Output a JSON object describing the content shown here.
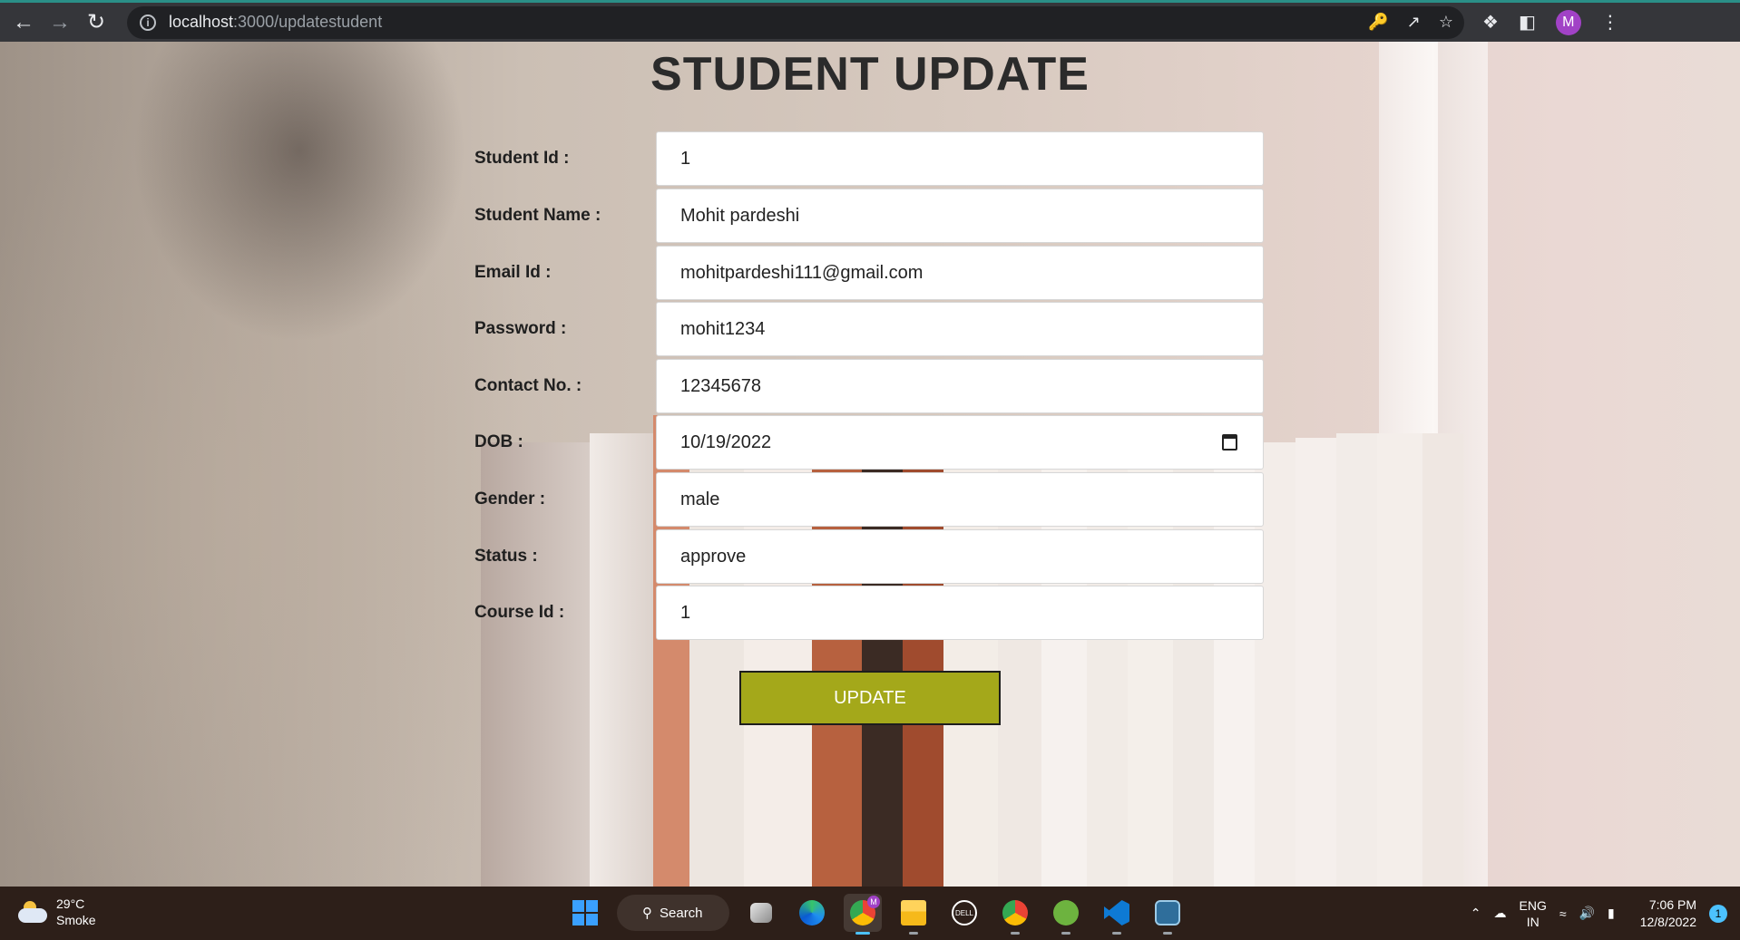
{
  "browser": {
    "url_host": "localhost",
    "url_path": ":3000/updatestudent",
    "profile_initial": "M"
  },
  "page": {
    "title": "STUDENT UPDATE",
    "fields": [
      {
        "label": "Student Id :",
        "value": "1"
      },
      {
        "label": "Student Name :",
        "value": "Mohit pardeshi"
      },
      {
        "label": "Email Id :",
        "value": "mohitpardeshi111@gmail.com"
      },
      {
        "label": "Password :",
        "value": "mohit1234"
      },
      {
        "label": "Contact No. :",
        "value": "12345678"
      },
      {
        "label": "DOB :",
        "value": "10/19/2022"
      },
      {
        "label": "Gender :",
        "value": "male"
      },
      {
        "label": "Status :",
        "value": "approve"
      },
      {
        "label": "Course Id :",
        "value": "1"
      }
    ],
    "update_label": "UPDATE",
    "accent_color": "#a4a81a"
  },
  "taskbar": {
    "weather_temp": "29°C",
    "weather_desc": "Smoke",
    "search_label": "Search",
    "lang_top": "ENG",
    "lang_bottom": "IN",
    "time": "7:06 PM",
    "date": "12/8/2022",
    "notifications": "1",
    "chrome_badge": "M"
  }
}
